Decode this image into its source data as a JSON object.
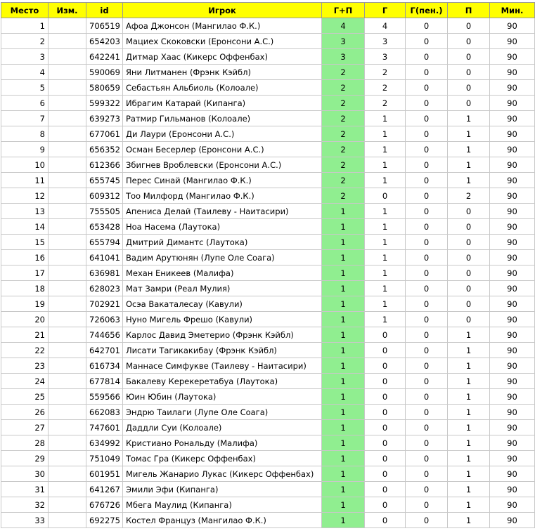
{
  "table": {
    "headers": [
      "Место",
      "Изм.",
      "id",
      "Игрок",
      "Г+П",
      "Г",
      "Г(пен.)",
      "П",
      "Мин."
    ],
    "highlight_colors": {
      "header": "#ffff00",
      "gp_column": "#90ee90"
    },
    "rows": [
      [
        "1",
        "",
        "706519",
        "Афоа Джонсон (Мангилао Ф.К.)",
        "4",
        "4",
        "0",
        "0",
        "90"
      ],
      [
        "2",
        "",
        "654203",
        "Мациех Скоковски (Еронсони А.С.)",
        "3",
        "3",
        "0",
        "0",
        "90"
      ],
      [
        "3",
        "",
        "642241",
        "Дитмар Хаас (Кикерс Оффенбах)",
        "3",
        "3",
        "0",
        "0",
        "90"
      ],
      [
        "4",
        "",
        "590069",
        "Яни Литманен (Фрэнк Кэйбл)",
        "2",
        "2",
        "0",
        "0",
        "90"
      ],
      [
        "5",
        "",
        "580659",
        "Себастьян Альбиоль (Колоале)",
        "2",
        "2",
        "0",
        "0",
        "90"
      ],
      [
        "6",
        "",
        "599322",
        "Ибрагим Катарай (Кипанга)",
        "2",
        "2",
        "0",
        "0",
        "90"
      ],
      [
        "7",
        "",
        "639273",
        "Ратмир Гильманов (Колоале)",
        "2",
        "1",
        "0",
        "1",
        "90"
      ],
      [
        "8",
        "",
        "677061",
        "Ди Лаури (Еронсони А.С.)",
        "2",
        "1",
        "0",
        "1",
        "90"
      ],
      [
        "9",
        "",
        "656352",
        "Осман Бесерлер (Еронсони А.С.)",
        "2",
        "1",
        "0",
        "1",
        "90"
      ],
      [
        "10",
        "",
        "612366",
        "Збигнев Вроблевски (Еронсони А.С.)",
        "2",
        "1",
        "0",
        "1",
        "90"
      ],
      [
        "11",
        "",
        "655745",
        "Перес Синай (Мангилао Ф.К.)",
        "2",
        "1",
        "0",
        "1",
        "90"
      ],
      [
        "12",
        "",
        "609312",
        "Тоо Милфорд (Мангилао Ф.К.)",
        "2",
        "0",
        "0",
        "2",
        "90"
      ],
      [
        "13",
        "",
        "755505",
        "Апениса Делай (Таилеву - Наитасири)",
        "1",
        "1",
        "0",
        "0",
        "90"
      ],
      [
        "14",
        "",
        "653428",
        "Ноа Насема (Лаутока)",
        "1",
        "1",
        "0",
        "0",
        "90"
      ],
      [
        "15",
        "",
        "655794",
        "Дмитрий Димантс (Лаутока)",
        "1",
        "1",
        "0",
        "0",
        "90"
      ],
      [
        "16",
        "",
        "641041",
        "Вадим Арутюнян (Лупе Оле Соага)",
        "1",
        "1",
        "0",
        "0",
        "90"
      ],
      [
        "17",
        "",
        "636981",
        "Механ Еникеев (Малифа)",
        "1",
        "1",
        "0",
        "0",
        "90"
      ],
      [
        "18",
        "",
        "628023",
        "Мат Замри (Реал Мулия)",
        "1",
        "1",
        "0",
        "0",
        "90"
      ],
      [
        "19",
        "",
        "702921",
        "Осэа Вакаталесау (Кавули)",
        "1",
        "1",
        "0",
        "0",
        "90"
      ],
      [
        "20",
        "",
        "726063",
        "Нуно Мигель Фрешо (Кавули)",
        "1",
        "1",
        "0",
        "0",
        "90"
      ],
      [
        "21",
        "",
        "744656",
        "Карлос Давид Эметерио (Фрэнк Кэйбл)",
        "1",
        "0",
        "0",
        "1",
        "90"
      ],
      [
        "22",
        "",
        "642701",
        "Лисати Тагикакибау (Фрэнк Кэйбл)",
        "1",
        "0",
        "0",
        "1",
        "90"
      ],
      [
        "23",
        "",
        "616734",
        "Маннасе Симфукве (Таилеву - Наитасири)",
        "1",
        "0",
        "0",
        "1",
        "90"
      ],
      [
        "24",
        "",
        "677814",
        "Бакалеву Керекеретабуа (Лаутока)",
        "1",
        "0",
        "0",
        "1",
        "90"
      ],
      [
        "25",
        "",
        "559566",
        "Юин Юбин (Лаутока)",
        "1",
        "0",
        "0",
        "1",
        "90"
      ],
      [
        "26",
        "",
        "662083",
        "Эндрю Таилаги (Лупе Оле Соага)",
        "1",
        "0",
        "0",
        "1",
        "90"
      ],
      [
        "27",
        "",
        "747601",
        "Даддли Суи (Колоале)",
        "1",
        "0",
        "0",
        "1",
        "90"
      ],
      [
        "28",
        "",
        "634992",
        "Кристиано Рональду (Малифа)",
        "1",
        "0",
        "0",
        "1",
        "90"
      ],
      [
        "29",
        "",
        "751049",
        "Томас Гра (Кикерс Оффенбах)",
        "1",
        "0",
        "0",
        "1",
        "90"
      ],
      [
        "30",
        "",
        "601951",
        "Мигель Жанарио Лукас (Кикерс Оффенбах)",
        "1",
        "0",
        "0",
        "1",
        "90"
      ],
      [
        "31",
        "",
        "641267",
        "Эмили Эфи (Кипанга)",
        "1",
        "0",
        "0",
        "1",
        "90"
      ],
      [
        "32",
        "",
        "676726",
        "Мбега Маулид (Кипанга)",
        "1",
        "0",
        "0",
        "1",
        "90"
      ],
      [
        "33",
        "",
        "692275",
        "Костел Француз (Мангилао Ф.К.)",
        "1",
        "0",
        "0",
        "1",
        "90"
      ]
    ]
  }
}
